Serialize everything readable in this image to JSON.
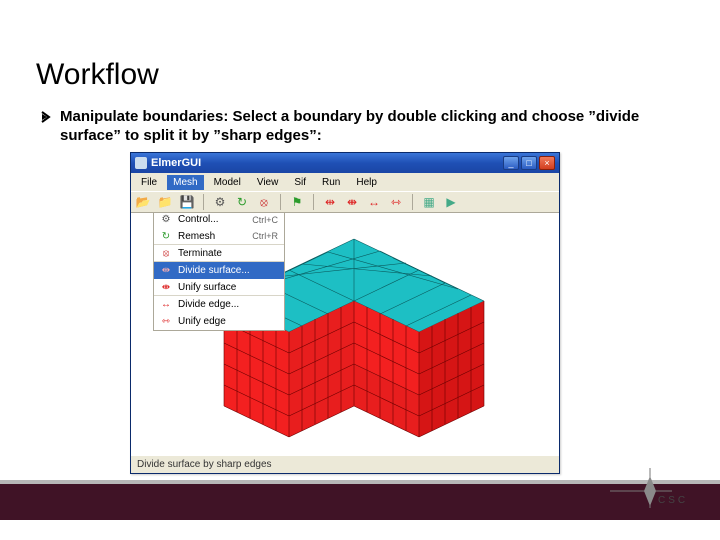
{
  "slide": {
    "title": "Workflow",
    "bullet_text": "Manipulate boundaries: Select a boundary by double clicking and choose ”divide surface” to split it by ”sharp edges”:"
  },
  "app": {
    "title": "ElmerGUI",
    "menus": [
      "File",
      "Mesh",
      "Model",
      "View",
      "Sif",
      "Run",
      "Help"
    ],
    "open_menu_index": 1,
    "dropdown": [
      {
        "label": "Control...",
        "shortcut": "Ctrl+C",
        "icon": "gear"
      },
      {
        "label": "Remesh",
        "shortcut": "Ctrl+R",
        "icon": "refresh",
        "sep_after": true
      },
      {
        "label": "Terminate",
        "shortcut": "",
        "icon": "stop",
        "sep_after": true
      },
      {
        "label": "Divide surface...",
        "shortcut": "",
        "icon": "divide-red",
        "highlight": true
      },
      {
        "label": "Unify surface",
        "shortcut": "",
        "icon": "unify-red",
        "sep_after": true
      },
      {
        "label": "Divide edge...",
        "shortcut": "",
        "icon": "divide-red"
      },
      {
        "label": "Unify edge",
        "shortcut": "",
        "icon": "unify-red"
      }
    ],
    "status_text": "Divide surface by sharp edges"
  },
  "footer": {
    "brand": "CSC"
  }
}
